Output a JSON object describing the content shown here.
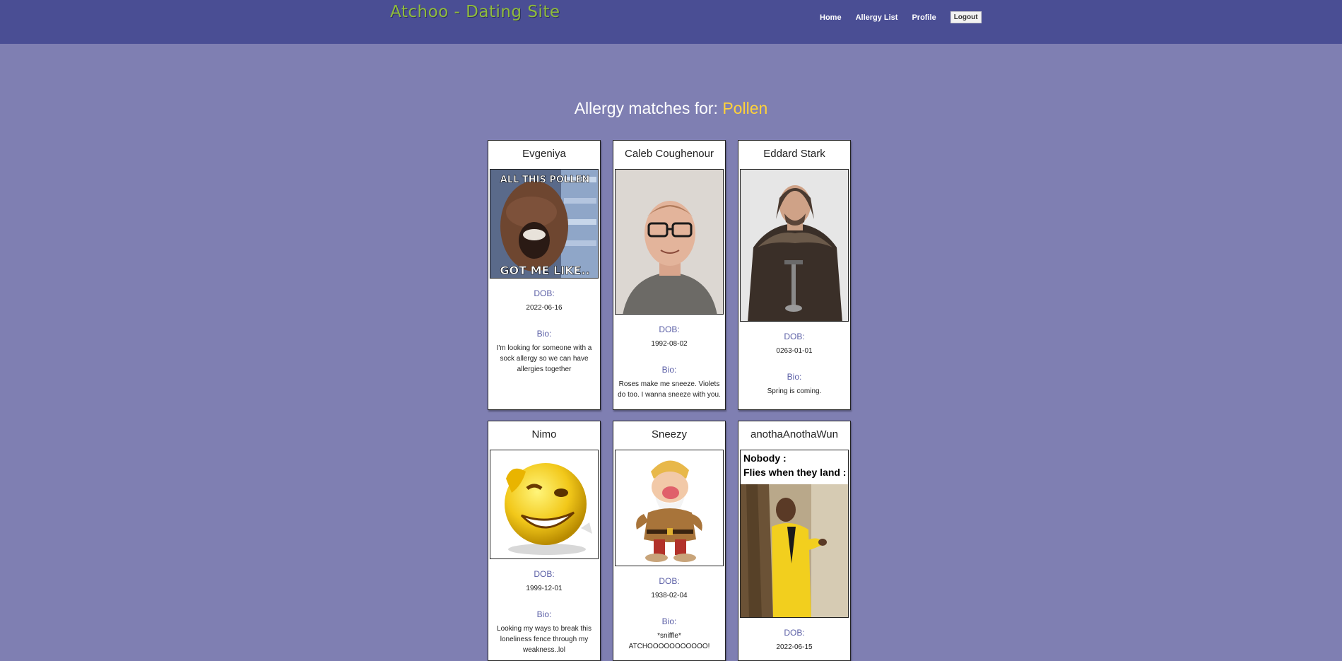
{
  "header": {
    "brand": "Atchoo - Dating Site",
    "nav": {
      "home": "Home",
      "allergy_list": "Allergy List",
      "profile": "Profile",
      "logout": "Logout"
    }
  },
  "page": {
    "heading_prefix": "Allergy matches for:",
    "allergy": "Pollen"
  },
  "labels": {
    "dob": "DOB:",
    "bio": "Bio:"
  },
  "matches": [
    {
      "name": "Evgeniya",
      "dob": "2022-06-16",
      "bio": "I'm looking for someone with a sock allergy so we can have allergies together",
      "photo_text_top": "ALL THIS POLLEN",
      "photo_text_bottom": "GOT ME LIKE.."
    },
    {
      "name": "Caleb Coughenour",
      "dob": "1992-08-02",
      "bio": "Roses make me sneeze. Violets do too. I wanna sneeze with you."
    },
    {
      "name": "Eddard Stark",
      "dob": "0263-01-01",
      "bio": "Spring is coming."
    },
    {
      "name": "Nimo",
      "dob": "1999-12-01",
      "bio": "Looking my ways to break this loneliness fence through my weakness..lol"
    },
    {
      "name": "Sneezy",
      "dob": "1938-02-04",
      "bio": "*sniffle* ATCHOOOOOOOOOOO!"
    },
    {
      "name": "anothaAnothaWun",
      "dob": "2022-06-15",
      "bio": "",
      "photo_text_top": "Nobody :",
      "photo_text_bottom": "Flies when they land :"
    }
  ]
}
